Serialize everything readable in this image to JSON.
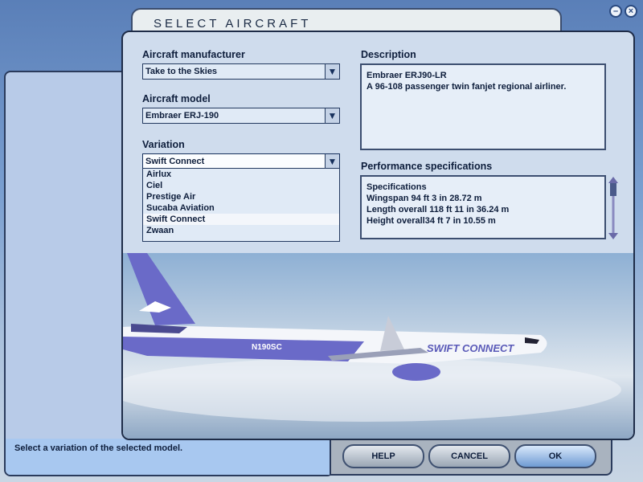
{
  "window": {
    "title": "SELECT AIRCRAFT",
    "minimize_icon": "minimize-icon",
    "close_icon": "close-icon"
  },
  "manufacturer": {
    "label": "Aircraft manufacturer",
    "value": "Take to the Skies"
  },
  "model": {
    "label": "Aircraft model",
    "value": "Embraer ERJ-190"
  },
  "variation": {
    "label": "Variation",
    "value": "Swift Connect",
    "options": [
      "Airlux",
      "Ciel",
      "Prestige Air",
      "Sucaba Aviation",
      "Swift Connect",
      "Zwaan"
    ],
    "selected_index": 4
  },
  "description": {
    "label": "Description",
    "lines": [
      "Embraer ERJ90-LR",
      "A 96-108 passenger twin fanjet regional airliner."
    ]
  },
  "performance": {
    "label": "Performance specifications",
    "lines": [
      "Specifications",
      "Wingspan 94 ft 3 in 28.72 m",
      "Length overall 118 ft 11 in 36.24 m",
      "Height overall34 ft 7 in 10.55 m"
    ]
  },
  "preview": {
    "registration": "N190SC",
    "livery_logo": "SWIFT CONNECT",
    "accent": "#6a6ac8"
  },
  "status": "Select a variation of the selected model.",
  "buttons": {
    "help": "HELP",
    "cancel": "CANCEL",
    "ok": "OK"
  }
}
